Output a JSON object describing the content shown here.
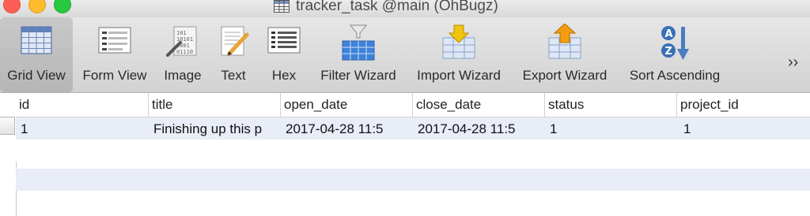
{
  "window": {
    "title": "tracker_task @main (OhBugz)"
  },
  "toolbar": {
    "items": [
      {
        "label": "Grid View",
        "icon": "grid-view-icon",
        "selected": true
      },
      {
        "label": "Form View",
        "icon": "form-view-icon"
      },
      {
        "label": "Image",
        "icon": "image-icon"
      },
      {
        "label": "Text",
        "icon": "text-icon"
      },
      {
        "label": "Hex",
        "icon": "hex-icon"
      },
      {
        "label": "Filter Wizard",
        "icon": "filter-wizard-icon"
      },
      {
        "label": "Import Wizard",
        "icon": "import-wizard-icon"
      },
      {
        "label": "Export Wizard",
        "icon": "export-wizard-icon"
      },
      {
        "label": "Sort Ascending",
        "icon": "sort-ascending-icon"
      }
    ],
    "overflow": "››"
  },
  "table": {
    "columns": [
      "id",
      "title",
      "open_date",
      "close_date",
      "status",
      "project_id"
    ],
    "rows": [
      [
        "1",
        "Finishing up this p",
        "2017-04-28 11:5",
        "2017-04-28 11:5",
        "1",
        "1"
      ]
    ]
  },
  "colors": {
    "stripe": "#e8edf7",
    "selected_tool": "#c4c4c4"
  }
}
